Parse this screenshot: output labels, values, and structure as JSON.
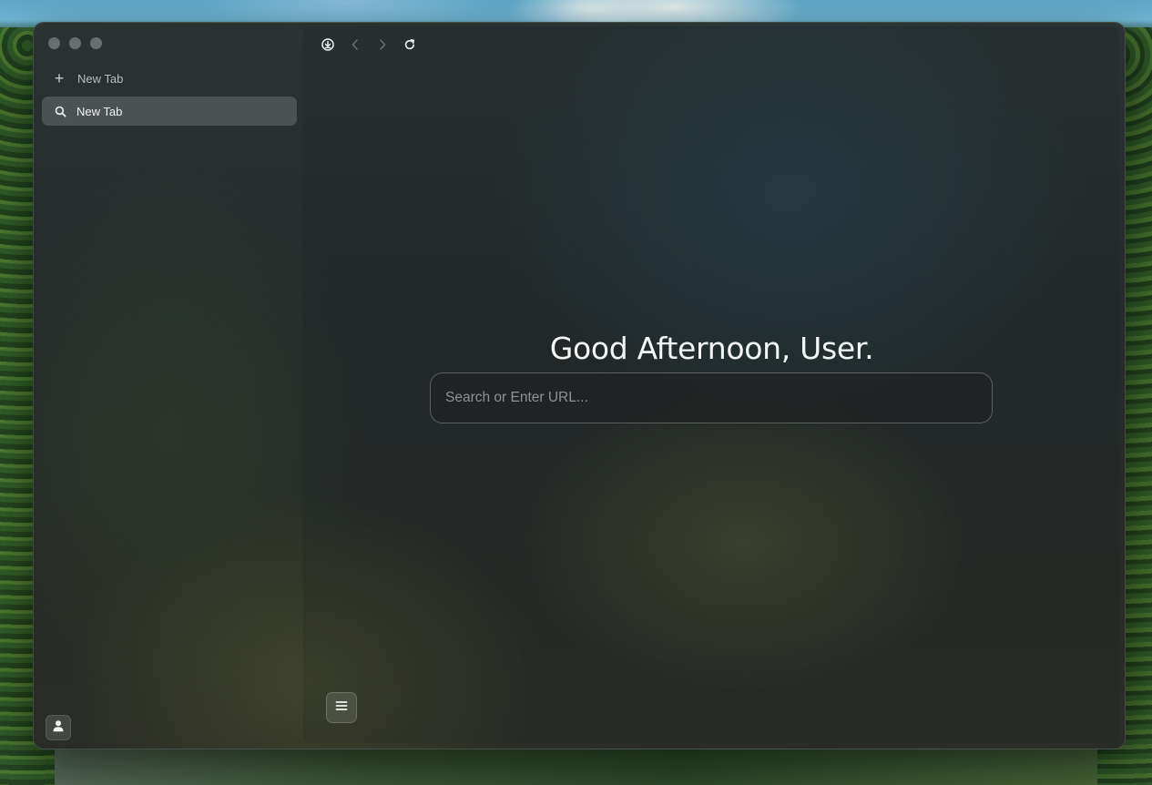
{
  "sidebar": {
    "new_tab_label": "New Tab",
    "tabs": [
      {
        "label": "New Tab",
        "icon": "search-icon",
        "active": true
      }
    ]
  },
  "toolbar": {
    "icons": [
      "download-icon",
      "back-icon",
      "forward-icon",
      "reload-icon"
    ]
  },
  "main": {
    "greeting": "Good Afternoon, User.",
    "search_placeholder": "Search or Enter URL..."
  },
  "colors": {
    "text_primary": "#f4f6f6",
    "tab_active_bg": "rgba(200,205,210,0.22)"
  }
}
